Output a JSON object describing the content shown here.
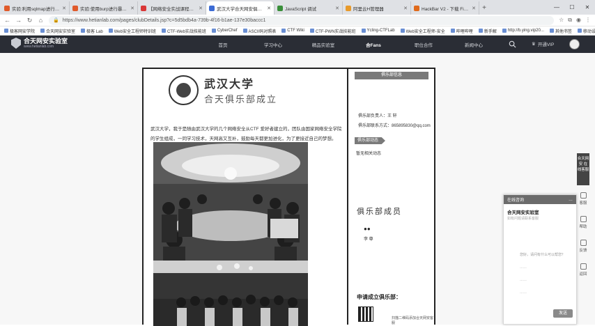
{
  "browser": {
    "tabs": [
      {
        "title": "实验:利用sqlmap进行简要注",
        "color": "#e05a2b"
      },
      {
        "title": "实验:使用burp进行暴力破解|合",
        "color": "#e05a2b"
      },
      {
        "title": "【网络安全实战课程】_BV1",
        "color": "#d93636"
      },
      {
        "title": "武汉大学合天网安俱乐部-合天网",
        "color": "#3c6bd4"
      },
      {
        "title": "JavaScript 调试",
        "color": "#3a8f3a"
      },
      {
        "title": "阿里云H管理器",
        "color": "#e89a2b"
      },
      {
        "title": "HackBar V2 - 下载 Firefox 扩",
        "color": "#e06a1b"
      }
    ],
    "active_tab": 3,
    "new_tab": "+",
    "window_controls": [
      "—",
      "☐",
      "✕"
    ],
    "url": "https://www.hetianlab.com/pages/clubDetails.jsp?c=5d5bdb4a-739b-4f16-b1ae-137e30baccc1",
    "bookmarks": [
      "极客网安学院",
      "合天网安实验室",
      "极客 Lab",
      "Web安全工程师特训班",
      "CTF-Web实战技能班",
      "CyberChef",
      "ASCII码对照表",
      "CTF Wiki",
      "CTF-PWN实战技能班",
      "Ycling-CTFLab",
      "Web安全工程师-安全",
      "哔哩哔哩",
      "新手解",
      "http://b.ying.vip20...",
      "其他书签",
      "移动设备上的书签"
    ]
  },
  "site": {
    "logo_title": "合天网安实验室",
    "logo_sub": "www.hetianlab.com",
    "menu": [
      "首页",
      "学习中心",
      "精品实验室",
      "合Fans",
      "职位合作",
      "新闻中心"
    ],
    "active_menu": 3,
    "vip_label": "开通VIP"
  },
  "article": {
    "uni_name": "武汉大学",
    "club_title": "合天俱乐部成立",
    "intro": "武汉大学，我于是随由武汉大学的几个网络安全从CTF 爱好者建立的，团队由国家网络安全学院的学生组成，一同学习技术，天网高又互补，鼓励每天都更加进化，为了更接近自己的梦想。"
  },
  "sidebar": {
    "head": "俱乐部信息",
    "leader": "俱乐部负责人：王 轩",
    "contact": "俱乐部联系方式：865895830@qq.com",
    "news_tag": "俱乐部动态",
    "news_empty": "暂无相关动态",
    "members_title": "俱乐部成员",
    "member_name": "李 尊",
    "apply": "申请成立俱乐部：",
    "qr_caption": "扫描二维码添加合天网安客服"
  },
  "rail": {
    "top": "合天网安 在线客服",
    "items": [
      "客服",
      "帮助",
      "反馈",
      "返回"
    ]
  },
  "chat": {
    "header": "在线咨询",
    "org": "合天网安实验室",
    "sub": "如有问题请联系客服",
    "lines": [
      "您好，请问有什么可以帮您？",
      "……",
      "……",
      "……"
    ],
    "send": "发送"
  }
}
